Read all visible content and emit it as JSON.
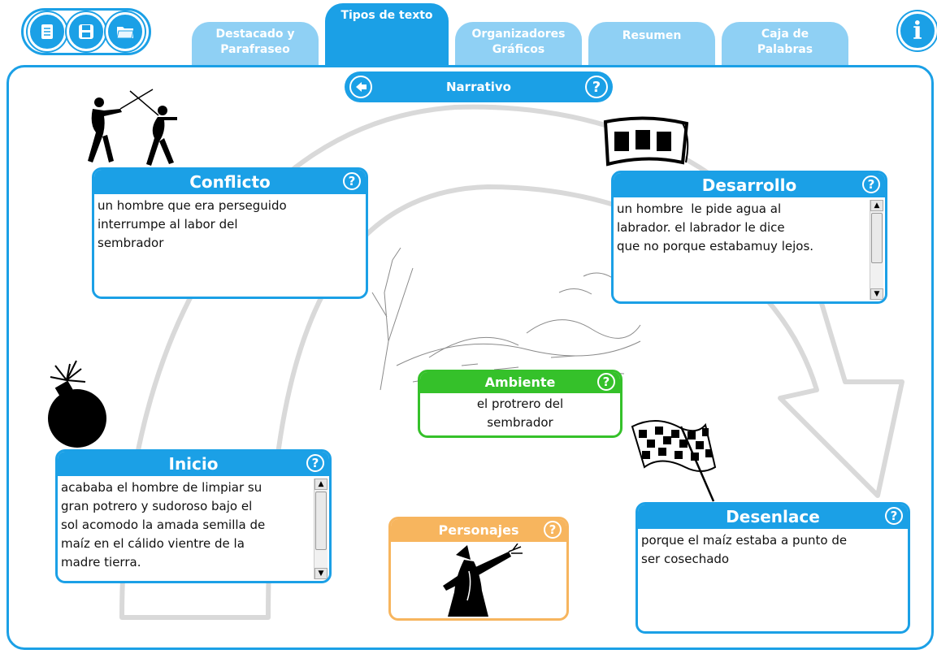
{
  "toolbar": {
    "buttons": [
      {
        "name": "document-icon"
      },
      {
        "name": "save-icon"
      },
      {
        "name": "folder-icon"
      }
    ],
    "info_label": "i"
  },
  "tabs": [
    {
      "label": "Destacado y\nParafraseo",
      "active": false
    },
    {
      "label": "Tipos de texto",
      "active": true
    },
    {
      "label": "Organizadores\nGráficos",
      "active": false
    },
    {
      "label": "Resumen",
      "active": false
    },
    {
      "label": "Caja de\nPalabras",
      "active": false
    }
  ],
  "narrative_bar": {
    "title": "Narrativo",
    "back_icon": "arrow-left-icon",
    "help": "?"
  },
  "cards": {
    "conflicto": {
      "title": "Conflicto",
      "text": "un hombre que era perseguido\ninterrumpe al labor del\nsembrador"
    },
    "desarrollo": {
      "title": "Desarrollo",
      "text": "un hombre  le pide agua al\nlabrador. el labrador le dice\nque no porque estabamuy lejos."
    },
    "ambiente": {
      "title": "Ambiente",
      "text": "el protrero del\nsembrador"
    },
    "inicio": {
      "title": "Inicio",
      "text": "acababa el hombre de limpiar su\ngran potrero y sudoroso bajo el\nsol acomodo la amada semilla de\nmaíz en el cálido vientre de la\nmadre tierra."
    },
    "personajes": {
      "title": "Personajes",
      "text": ""
    },
    "desenlace": {
      "title": "Desenlace",
      "text": "porque el maíz estaba a punto de\nser cosechado"
    }
  },
  "help_label": "?",
  "colors": {
    "primary": "#1ba0e6",
    "tab_inactive": "#8fd0f4",
    "ambiente": "#35c12a",
    "personajes": "#f7b55e",
    "arc": "#d9d9d9"
  }
}
